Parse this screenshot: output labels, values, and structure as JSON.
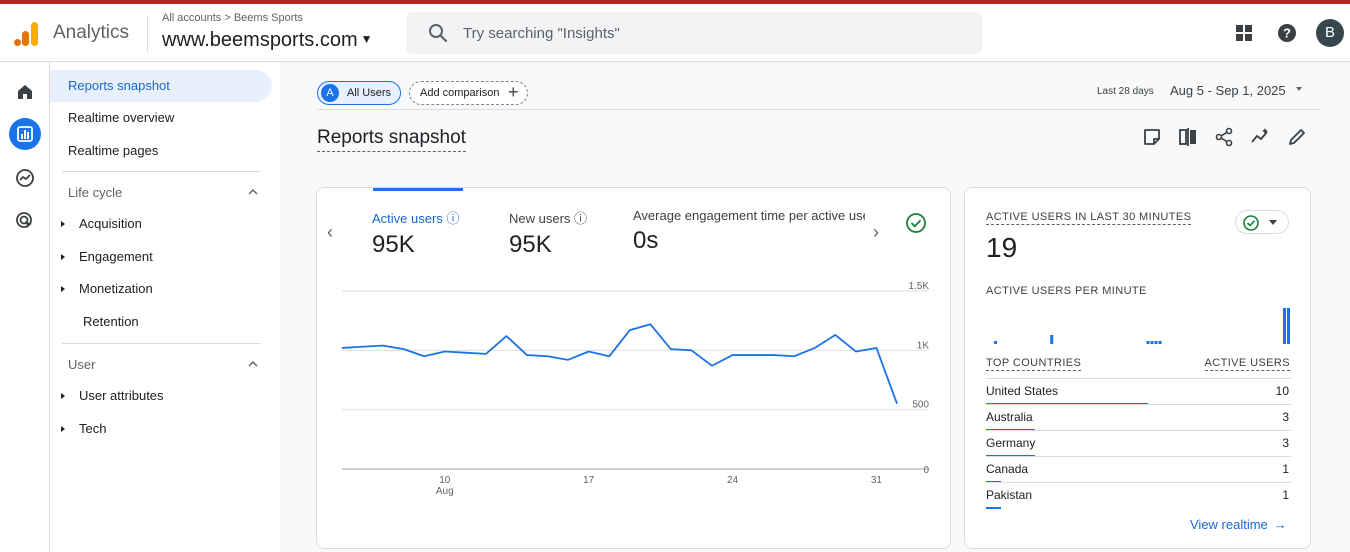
{
  "app": {
    "name": "Analytics",
    "breadcrumb": "All accounts > Beems Sports",
    "property": "www.beemsports.com",
    "brand_colors": {
      "bar_orange": "#f9ab00",
      "bar_dark": "#e37400"
    }
  },
  "search": {
    "placeholder": "Try searching \"Insights\""
  },
  "topbar_icons": [
    "apps-grid-icon",
    "help-icon"
  ],
  "user": {
    "avatar_initial": "B"
  },
  "rail": [
    {
      "name": "home-icon",
      "active": false
    },
    {
      "name": "reports-icon",
      "active": true
    },
    {
      "name": "explore-icon",
      "active": false
    },
    {
      "name": "advertising-icon",
      "active": false
    }
  ],
  "nav": {
    "top_items": [
      "Reports snapshot",
      "Realtime overview",
      "Realtime pages"
    ],
    "active_item": "Reports snapshot",
    "sections": [
      {
        "title": "Life cycle",
        "items": [
          {
            "label": "Acquisition",
            "expandable": true
          },
          {
            "label": "Engagement",
            "expandable": true
          },
          {
            "label": "Monetization",
            "expandable": true
          },
          {
            "label": "Retention",
            "expandable": false
          }
        ]
      },
      {
        "title": "User",
        "items": [
          {
            "label": "User attributes",
            "expandable": true
          },
          {
            "label": "Tech",
            "expandable": true
          }
        ]
      }
    ]
  },
  "comparison": {
    "segment_badge": "A",
    "segment_label": "All Users",
    "add_label": "Add comparison"
  },
  "date": {
    "preset": "Last 28 days",
    "range": "Aug 5 - Sep 1, 2025"
  },
  "page_title": "Reports snapshot",
  "toolbar_icons": [
    "edit-note-icon",
    "compare-columns-icon",
    "share-icon",
    "insights-icon",
    "pencil-icon"
  ],
  "metrics": [
    {
      "label": "Active users",
      "value": "95K",
      "selected": true
    },
    {
      "label": "New users",
      "value": "95K",
      "selected": false
    },
    {
      "label": "Average engagement time per active user",
      "value": "0s",
      "selected": false
    }
  ],
  "chart_data": {
    "type": "line",
    "series": [
      {
        "values": [
          1020,
          1030,
          1040,
          1010,
          950,
          990,
          980,
          970,
          1120,
          960,
          950,
          920,
          990,
          950,
          1170,
          1220,
          1010,
          1000,
          870,
          960,
          960,
          960,
          950,
          1020,
          1130,
          990,
          1020,
          550
        ]
      }
    ],
    "x_start_day": 5,
    "x_tick_labels": [
      {
        "day": 10,
        "label": "10",
        "sublabel": "Aug"
      },
      {
        "day": 17,
        "label": "17",
        "sublabel": ""
      },
      {
        "day": 24,
        "label": "24",
        "sublabel": ""
      },
      {
        "day": 31,
        "label": "31",
        "sublabel": ""
      }
    ],
    "y_ticks": [
      {
        "value": 1500,
        "label": "1.5K"
      },
      {
        "value": 1000,
        "label": "1K"
      },
      {
        "value": 500,
        "label": "500"
      },
      {
        "value": 0,
        "label": "0"
      }
    ],
    "ylim": [
      0,
      1500
    ],
    "grid": true,
    "color": "#1a73e8"
  },
  "realtime": {
    "title": "ACTIVE USERS IN LAST 30 MINUTES",
    "value": "19",
    "per_minute_label": "ACTIVE USERS PER MINUTE",
    "per_minute": [
      0,
      0,
      1,
      0,
      0,
      0,
      0,
      0,
      0,
      0,
      0,
      0,
      0,
      0,
      0,
      0,
      3,
      0,
      0,
      0,
      0,
      0,
      0,
      0,
      0,
      0,
      0,
      0,
      0,
      0,
      0,
      0,
      0,
      0,
      0,
      0,
      0,
      0,
      0,
      0,
      1,
      1,
      1,
      1,
      0,
      0,
      0,
      0,
      0,
      0,
      0,
      0,
      0,
      0,
      0,
      0,
      0,
      0,
      0,
      0,
      0,
      0,
      0,
      0,
      0,
      0,
      0,
      0,
      0,
      0,
      0,
      0,
      0,
      0,
      12,
      12
    ],
    "col_countries": "TOP COUNTRIES",
    "col_users": "ACTIVE USERS",
    "rows": [
      {
        "country": "United States",
        "count": "10",
        "share": 0.53
      },
      {
        "country": "Australia",
        "count": "3",
        "share": 0.16
      },
      {
        "country": "Germany",
        "count": "3",
        "share": 0.16
      },
      {
        "country": "Canada",
        "count": "1",
        "share": 0.05
      },
      {
        "country": "Pakistan",
        "count": "1",
        "share": 0.05
      }
    ],
    "view_link": "View realtime"
  }
}
